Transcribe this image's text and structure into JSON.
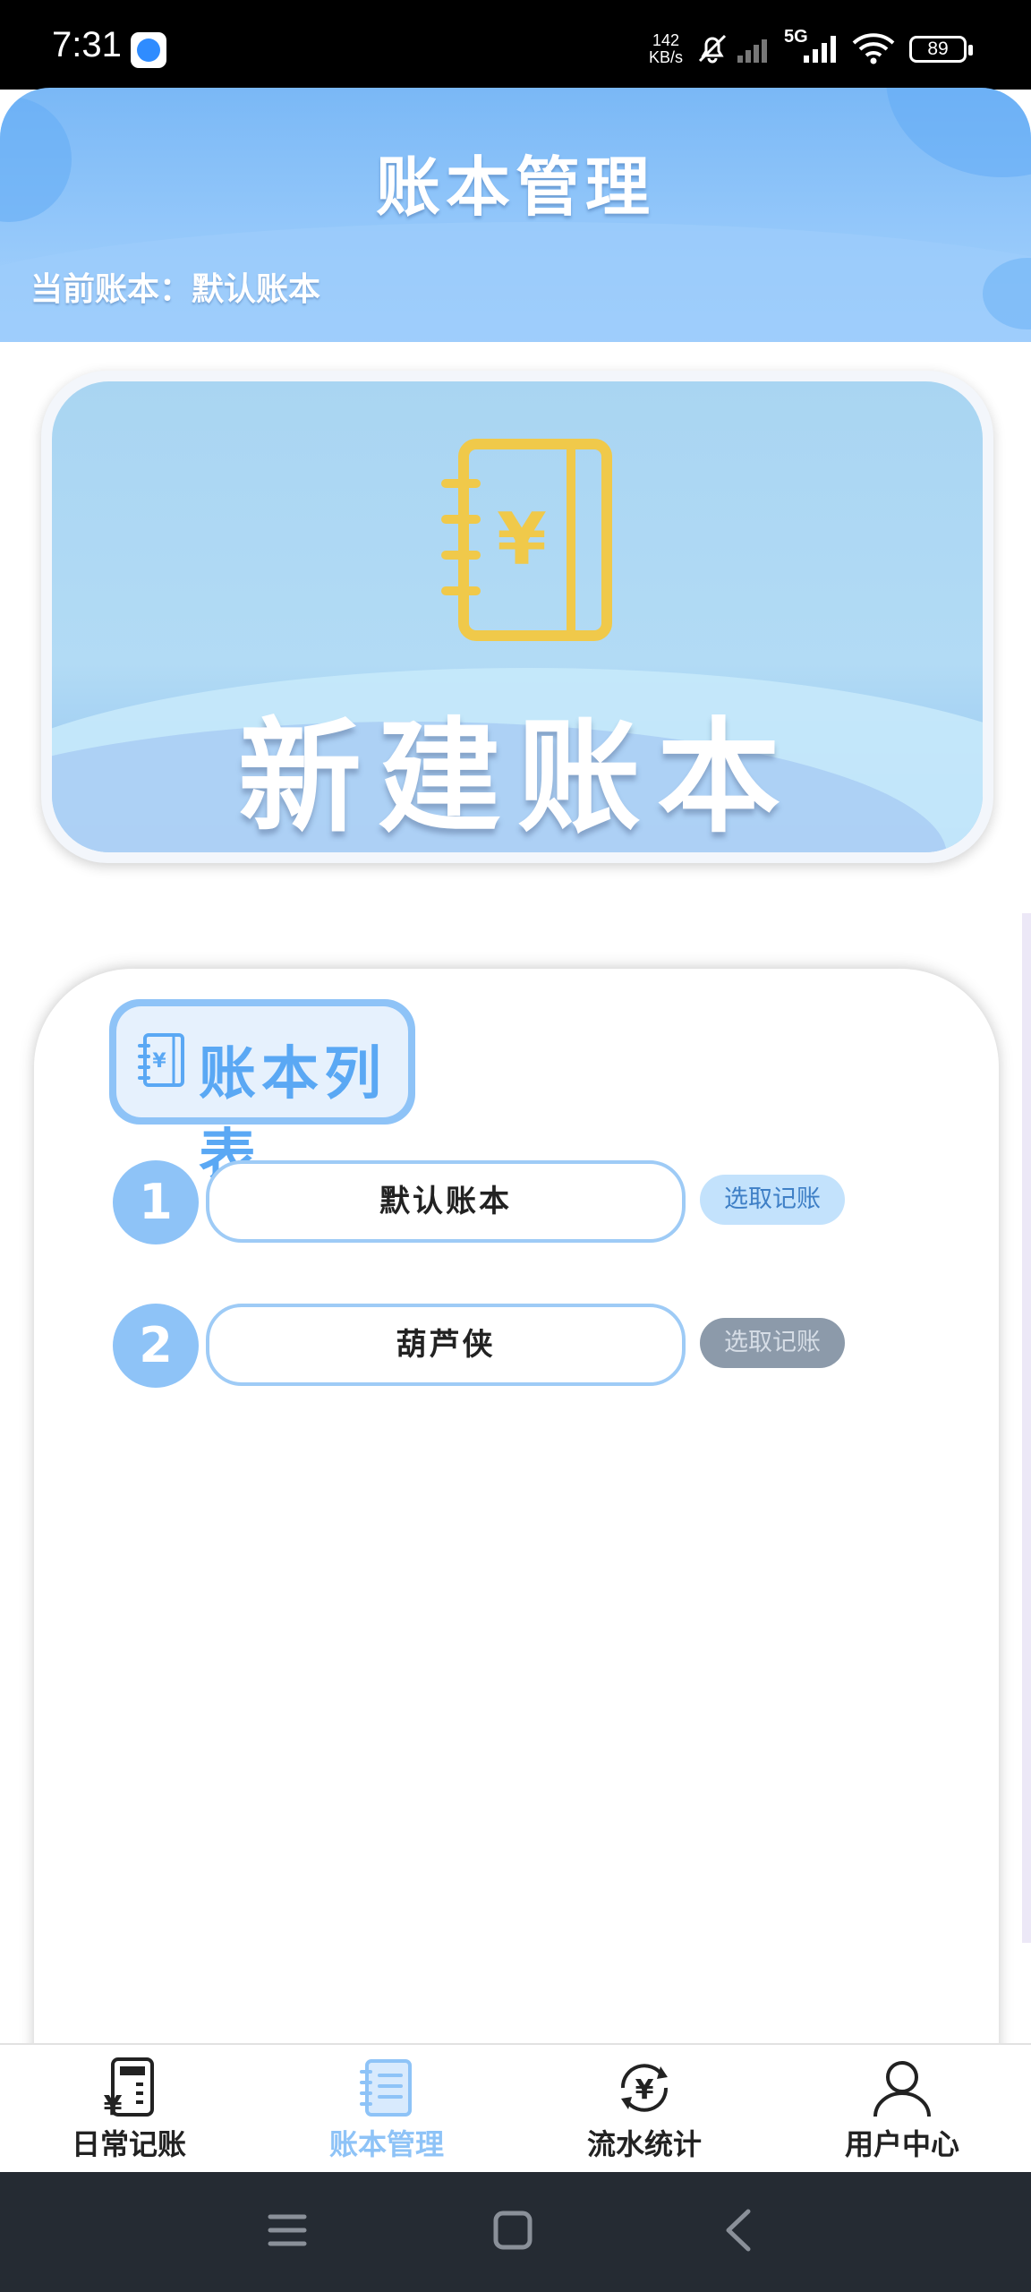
{
  "status_bar": {
    "time": "7:31",
    "net_speed_value": "142",
    "net_speed_unit": "KB/s",
    "network": "5G",
    "battery": "89"
  },
  "header": {
    "title": "账本管理",
    "current_book": "当前账本：默认账本"
  },
  "new_book_banner": {
    "label": "新建账本"
  },
  "book_list": {
    "title": "账本列表",
    "items": [
      {
        "index": "1",
        "name": "默认账本",
        "action": "选取记账",
        "state": "active"
      },
      {
        "index": "2",
        "name": "葫芦侠",
        "action": "选取记账",
        "state": "inactive"
      }
    ]
  },
  "tabbar": {
    "tabs": [
      {
        "label": "日常记账",
        "icon": "calculator-yen-icon"
      },
      {
        "label": "账本管理",
        "icon": "notebook-icon",
        "active": true
      },
      {
        "label": "流水统计",
        "icon": "yen-cycle-icon"
      },
      {
        "label": "用户中心",
        "icon": "user-icon"
      }
    ]
  },
  "colors": {
    "accent": "#8ec3f7",
    "header_bg": "#93c7fa",
    "inactive_button": "#8c9aaa",
    "nav_bg": "#252b33"
  }
}
